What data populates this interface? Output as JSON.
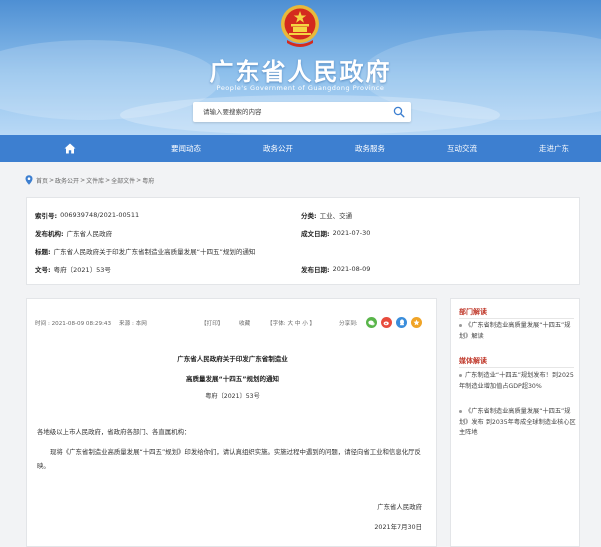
{
  "header": {
    "site_title": "广东省人民政府",
    "site_subtitle": "People's Government of Guangdong Province",
    "search_placeholder": "请输入要搜索的内容"
  },
  "nav": {
    "items": [
      "要闻动态",
      "政务公开",
      "政务服务",
      "互动交流",
      "走进广东"
    ]
  },
  "breadcrumb": [
    "首页",
    "政务公开",
    "文件库",
    "全部文件",
    "粤府"
  ],
  "info": {
    "index_label": "索引号:",
    "index_value": "006939748/2021-00511",
    "category_label": "分类:",
    "category_value": "工业、交通",
    "issuer_label": "发布机构:",
    "issuer_value": "广东省人民政府",
    "created_label": "成文日期:",
    "created_value": "2021-07-30",
    "title_label": "标题:",
    "title_value": "广东省人民政府关于印发广东省制造业高质量发展“十四五”规划的通知",
    "docno_label": "文号:",
    "docno_value": "粤府〔2021〕53号",
    "published_label": "发布日期:",
    "published_value": "2021-08-09"
  },
  "article": {
    "time": "时间 : 2021-08-09 08:29:43",
    "source": "来源 : 本网",
    "print": "【打印】",
    "favorite": "收藏",
    "font": "【字体: 大  中  小 】",
    "share": "分享到:",
    "title_line1": "广东省人民政府关于印发广东省制造业",
    "title_line2": "高质量发展“十四五”规划的通知",
    "doc_no": "粤府〔2021〕53号",
    "salutation": "各地级以上市人民政府，省政府各部门、各直属机构：",
    "body": "现将《广东省制造业高质量发展“十四五”规划》印发给你们，请认真组织实施。实施过程中遇到的问题，请径向省工业和信息化厅反映。",
    "signer": "广东省人民政府",
    "sign_date": "2021年7月30日"
  },
  "sidebar": {
    "dept_head": "部门解读",
    "dept_items": [
      "《广东省制造业高质量发展“十四五”规划》解读"
    ],
    "media_head": "媒体解读",
    "media_items": [
      "广东制造业“十四五”规划发布！到2025年制造业增加值占GDP超30%",
      "《广东省制造业高质量发展“十四五”规划》发布 到2035年粤成全球制造业核心区主阵地"
    ]
  },
  "colors": {
    "nav_blue": "#3d7fd0",
    "sidebar_head_red": "#c0392b"
  }
}
